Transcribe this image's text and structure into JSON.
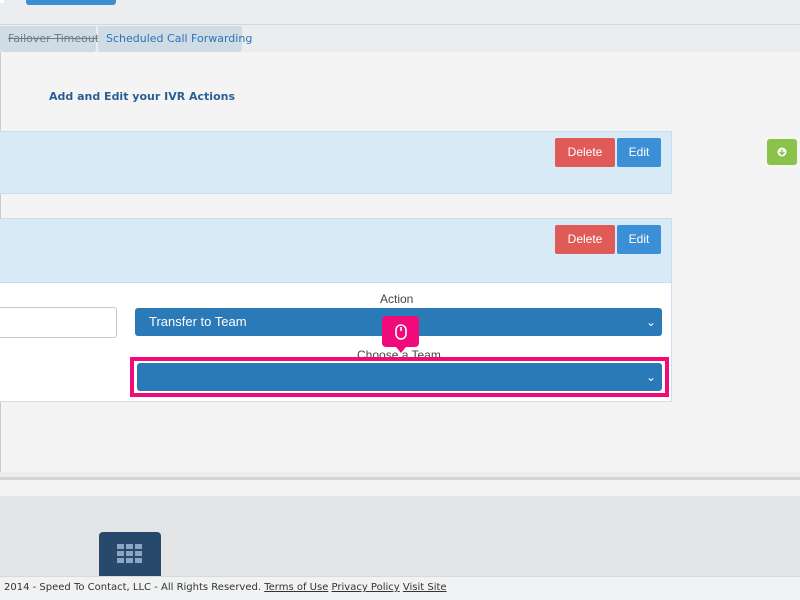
{
  "tabs": [
    {
      "label": "Failover Timeout",
      "state": "strikethrough"
    },
    {
      "label": "Scheduled Call Forwarding",
      "state": "normal"
    }
  ],
  "ivr": {
    "title": "Add and Edit your IVR Actions"
  },
  "rows": [
    {
      "delete_label": "Delete",
      "edit_label": "Edit"
    },
    {
      "delete_label": "Delete",
      "edit_label": "Edit"
    }
  ],
  "action_form": {
    "action_label": "Action",
    "action_value": "Transfer to Team",
    "team_label": "Choose a Team",
    "team_value": ""
  },
  "footer": {
    "copyright": "2014 - Speed To Contact, LLC - All Rights Reserved.",
    "terms": "Terms of Use",
    "privacy": "Privacy Policy",
    "visit": "Visit Site"
  },
  "colors": {
    "delete": "#e05b57",
    "edit": "#3b8fd6",
    "select": "#2a7ab8",
    "highlight": "#f00a7c",
    "add": "#8bc34a"
  },
  "icons": [
    "mouse-icon",
    "add-icon",
    "grid-icon",
    "chevron-down-icon"
  ]
}
